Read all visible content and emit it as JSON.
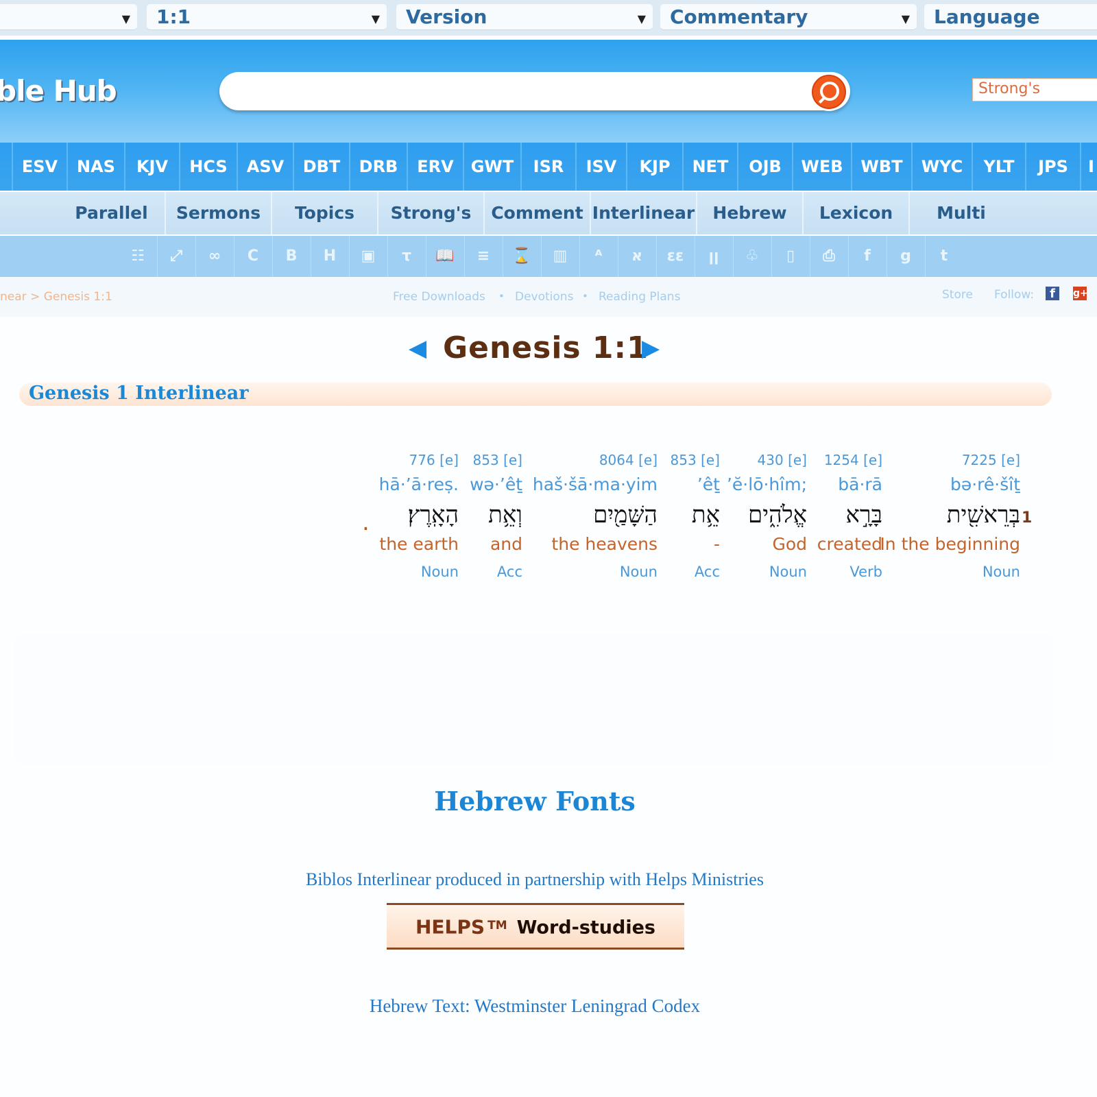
{
  "topbar": {
    "selects": [
      {
        "label": ""
      },
      {
        "label": "1:1"
      },
      {
        "label": "Version"
      },
      {
        "label": "Commentary"
      },
      {
        "label": "Language"
      }
    ],
    "arrow": "▼"
  },
  "header": {
    "logo": "ble Hub",
    "search_value": "",
    "strongs_label": "Strong's"
  },
  "versions": [
    "ESV",
    "NAS",
    "KJV",
    "HCS",
    "ASV",
    "DBT",
    "DRB",
    "ERV",
    "GWT",
    "ISR",
    "ISV",
    "KJP",
    "NET",
    "OJB",
    "WEB",
    "WBT",
    "WYC",
    "YLT",
    "JPS",
    "I"
  ],
  "nav": [
    "Parallel",
    "Sermons",
    "Topics",
    "Strong's",
    "Comment",
    "Interlinear",
    "Hebrew",
    "Lexicon",
    "Multi"
  ],
  "toolbar_icons": [
    {
      "name": "list-icon",
      "glyph": "☷"
    },
    {
      "name": "arrows-icon",
      "glyph": "⤢"
    },
    {
      "name": "link-icon",
      "glyph": "∞"
    },
    {
      "name": "c-icon",
      "glyph": "C"
    },
    {
      "name": "b-icon",
      "glyph": "B"
    },
    {
      "name": "h-icon",
      "glyph": "H"
    },
    {
      "name": "image-icon",
      "glyph": "▣"
    },
    {
      "name": "tau-icon",
      "glyph": "τ"
    },
    {
      "name": "book-icon",
      "glyph": "📖"
    },
    {
      "name": "bullets-icon",
      "glyph": "≡"
    },
    {
      "name": "hourglass-icon",
      "glyph": "⌛"
    },
    {
      "name": "bar-chart-icon",
      "glyph": "▥"
    },
    {
      "name": "language-icon",
      "glyph": "ᴬ"
    },
    {
      "name": "aleph-icon",
      "glyph": "א"
    },
    {
      "name": "epsilon-icon",
      "glyph": "εε"
    },
    {
      "name": "hebrew-icon",
      "glyph": "ןן"
    },
    {
      "name": "sitemap-icon",
      "glyph": "♧"
    },
    {
      "name": "mobile-icon",
      "glyph": "▯"
    },
    {
      "name": "print-icon",
      "glyph": "⎙"
    },
    {
      "name": "facebook-icon",
      "glyph": "f"
    },
    {
      "name": "google-plus-icon",
      "glyph": "g"
    },
    {
      "name": "twitter-icon",
      "glyph": "t"
    }
  ],
  "crumbs": {
    "path": "near > Genesis 1:1",
    "links": [
      "Free Downloads",
      "Devotions",
      "Reading Plans"
    ],
    "separator": "•",
    "store": "Store",
    "follow": "Follow:",
    "fb": "f",
    "gplus": "g+"
  },
  "verse": {
    "prev": "◀",
    "next": "▶",
    "title": "Genesis 1:1",
    "band_title": "Genesis 1 Interlinear",
    "number": "1",
    "end_mark": "."
  },
  "words": [
    {
      "num": "7225 [e]",
      "translit": "bə·rê·šîṯ",
      "hebrew": "בְּרֵאשִׁ֖ית",
      "english": "In the beginning",
      "pos": "Noun"
    },
    {
      "num": "1254 [e]",
      "translit": "bā·rā",
      "hebrew": "בָּרָ֣א",
      "english": "created",
      "pos": "Verb"
    },
    {
      "num": "430 [e]",
      "translit": "’ĕ·lō·hîm;",
      "hebrew": "אֱלֹהִ֑ים",
      "english": "God",
      "pos": "Noun"
    },
    {
      "num": "853 [e]",
      "translit": "’êṯ",
      "hebrew": "אֵ֥ת",
      "english": "-",
      "pos": "Acc"
    },
    {
      "num": "8064 [e]",
      "translit": "haš·šā·ma·yim",
      "hebrew": "הַשָּׁמַ֖יִם",
      "english": "the heavens",
      "pos": "Noun"
    },
    {
      "num": "853 [e]",
      "translit": "wə·’êṯ",
      "hebrew": "וְאֵ֥ת",
      "english": "and",
      "pos": "Acc"
    },
    {
      "num": "776 [e]",
      "translit": "hā·’ā·reṣ.",
      "hebrew": "הָאָֽרֶץ׃",
      "english": "the earth",
      "pos": "Noun"
    }
  ],
  "footer": {
    "fonts_link": "Hebrew Fonts",
    "partnership": "Biblos Interlinear produced in partnership with Helps Ministries",
    "helps": "HELPS",
    "tm": "TM",
    "word_studies": "Word-studies",
    "codex": "Hebrew Text: Westminster Leningrad Codex"
  }
}
